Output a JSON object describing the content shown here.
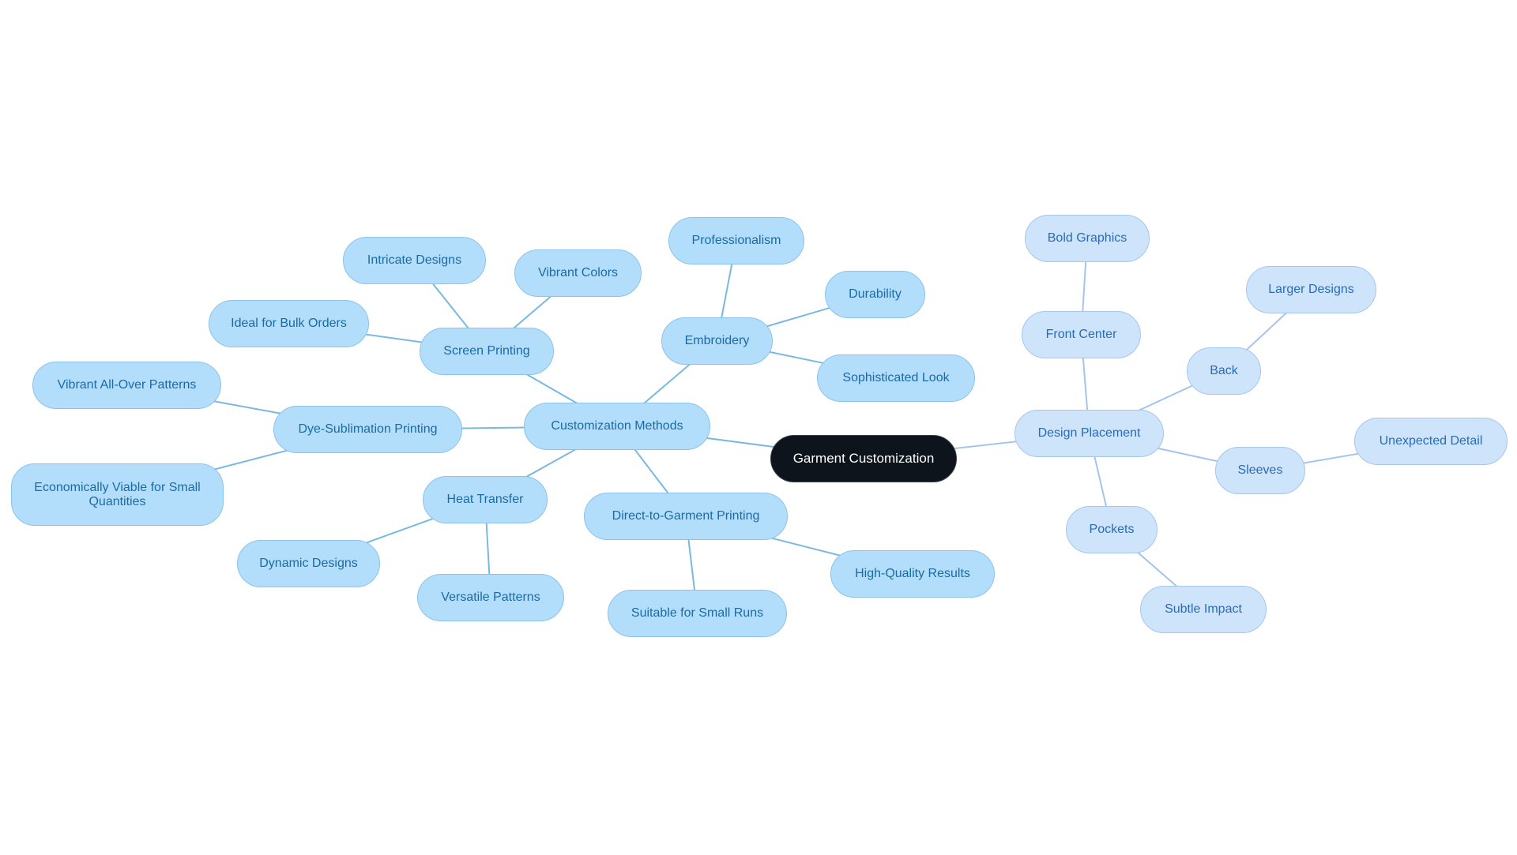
{
  "colors": {
    "root_fill": "#0d141c",
    "root_text": "#ffffff",
    "left_fill": "#b3defb",
    "left_text": "#1a6aa6",
    "left_edge": "#7ab8e0",
    "right_fill": "#cde4fb",
    "right_text": "#2a6bb6",
    "right_edge": "#a4c4ec"
  },
  "mindmap": {
    "root": {
      "id": "root",
      "label": "Garment Customization"
    },
    "nodes": [
      {
        "id": "methods",
        "label": "Customization Methods",
        "parent": "root",
        "branch": "left"
      },
      {
        "id": "screen",
        "label": "Screen Printing",
        "parent": "methods",
        "branch": "left"
      },
      {
        "id": "intricate",
        "label": "Intricate Designs",
        "parent": "screen",
        "branch": "left"
      },
      {
        "id": "vibrant-colors",
        "label": "Vibrant Colors",
        "parent": "screen",
        "branch": "left"
      },
      {
        "id": "bulk",
        "label": "Ideal for Bulk Orders",
        "parent": "screen",
        "branch": "left"
      },
      {
        "id": "embroidery",
        "label": "Embroidery",
        "parent": "methods",
        "branch": "left"
      },
      {
        "id": "professionalism",
        "label": "Professionalism",
        "parent": "embroidery",
        "branch": "left"
      },
      {
        "id": "durability",
        "label": "Durability",
        "parent": "embroidery",
        "branch": "left"
      },
      {
        "id": "sophisticated",
        "label": "Sophisticated Look",
        "parent": "embroidery",
        "branch": "left"
      },
      {
        "id": "dye",
        "label": "Dye-Sublimation Printing",
        "parent": "methods",
        "branch": "left"
      },
      {
        "id": "allover",
        "label": "Vibrant All-Over Patterns",
        "parent": "dye",
        "branch": "left"
      },
      {
        "id": "economical",
        "label": "Economically Viable for Small Quantities",
        "parent": "dye",
        "branch": "left"
      },
      {
        "id": "heat",
        "label": "Heat Transfer",
        "parent": "methods",
        "branch": "left"
      },
      {
        "id": "dynamic",
        "label": "Dynamic Designs",
        "parent": "heat",
        "branch": "left"
      },
      {
        "id": "versatile",
        "label": "Versatile Patterns",
        "parent": "heat",
        "branch": "left"
      },
      {
        "id": "dtg",
        "label": "Direct-to-Garment Printing",
        "parent": "methods",
        "branch": "left"
      },
      {
        "id": "small-runs",
        "label": "Suitable for Small Runs",
        "parent": "dtg",
        "branch": "left"
      },
      {
        "id": "high-quality",
        "label": "High-Quality Results",
        "parent": "dtg",
        "branch": "left"
      },
      {
        "id": "placement",
        "label": "Design Placement",
        "parent": "root",
        "branch": "right"
      },
      {
        "id": "front",
        "label": "Front Center",
        "parent": "placement",
        "branch": "right"
      },
      {
        "id": "bold",
        "label": "Bold Graphics",
        "parent": "front",
        "branch": "right"
      },
      {
        "id": "back",
        "label": "Back",
        "parent": "placement",
        "branch": "right"
      },
      {
        "id": "larger",
        "label": "Larger Designs",
        "parent": "back",
        "branch": "right"
      },
      {
        "id": "sleeves",
        "label": "Sleeves",
        "parent": "placement",
        "branch": "right"
      },
      {
        "id": "unexpected",
        "label": "Unexpected Detail",
        "parent": "sleeves",
        "branch": "right"
      },
      {
        "id": "pockets",
        "label": "Pockets",
        "parent": "placement",
        "branch": "right"
      },
      {
        "id": "subtle",
        "label": "Subtle Impact",
        "parent": "pockets",
        "branch": "right"
      }
    ]
  }
}
